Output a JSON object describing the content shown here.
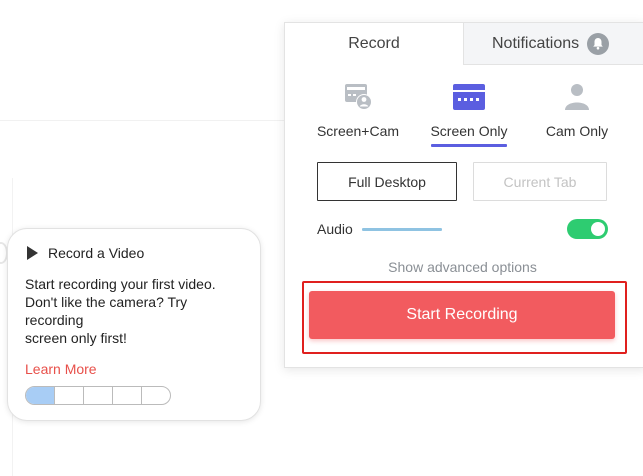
{
  "tabs": {
    "record": "Record",
    "notifications": "Notifications"
  },
  "modes": [
    {
      "label": "Screen+Cam",
      "icon": "screen-cam-icon",
      "selected": false
    },
    {
      "label": "Screen Only",
      "icon": "screen-only-icon",
      "selected": true
    },
    {
      "label": "Cam Only",
      "icon": "cam-only-icon",
      "selected": false
    }
  ],
  "capture": {
    "full_desktop": "Full Desktop",
    "current_tab": "Current Tab"
  },
  "audio": {
    "label": "Audio",
    "enabled": true
  },
  "advanced_link": "Show advanced options",
  "start_button": "Start Recording",
  "onboarding": {
    "title": "Record a Video",
    "body_lines": [
      "Start recording your first video.",
      "Don't like the camera? Try",
      "recording",
      "screen only first!"
    ],
    "learn_more": "Learn More",
    "progress_steps_total": 5,
    "progress_steps_done": 1
  },
  "colors": {
    "accent": "#5b5ee0",
    "start_button": "#f25b5f",
    "toggle_on": "#2ecc71",
    "learn_more": "#e8504a",
    "highlight_outline": "#e0201e"
  }
}
